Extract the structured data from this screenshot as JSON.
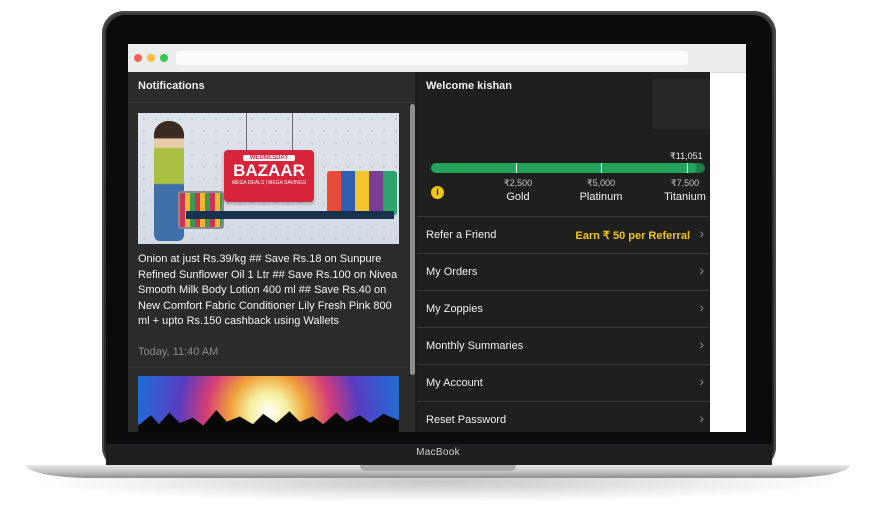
{
  "device": {
    "brand_label": "MacBook"
  },
  "notifications": {
    "title": "Notifications",
    "items": [
      {
        "banner_title": "BAZAAR",
        "banner_kicker": "WEDNESDAY",
        "banner_sub": "MEGA DEALS | MEGA SAVINGS",
        "text": "Onion at just Rs.39/kg ## Save Rs.18 on Sunpure Refined Sunflower Oil 1 Ltr ## Save Rs.100 on Nivea Smooth Milk Body Lotion 400 ml ## Save Rs.40 on New Comfort Fabric Conditioner Lily Fresh Pink 800 ml + upto Rs.150 cashback using Wallets",
        "time": "Today, 11:40 AM"
      }
    ]
  },
  "account": {
    "welcome": "Welcome kishan",
    "progress": {
      "current_value": 11051,
      "current_label": "₹11,051",
      "fraction": 0.97,
      "info_icon": "info-icon",
      "tiers": [
        {
          "amount": "₹2,500",
          "name": "Gold"
        },
        {
          "amount": "₹5,000",
          "name": "Platinum"
        },
        {
          "amount": "₹7,500",
          "name": "Titanium"
        }
      ]
    },
    "menu": [
      {
        "label": "Refer a Friend",
        "extra": "Earn ₹ 50 per Referral"
      },
      {
        "label": "My Orders"
      },
      {
        "label": "My Zoppies"
      },
      {
        "label": "Monthly Summaries"
      },
      {
        "label": "My Account"
      },
      {
        "label": "Reset Password"
      }
    ],
    "chevron": "›"
  },
  "colors": {
    "accent_yellow": "#f2c31a",
    "progress_green": "#24a35a",
    "panel_dark": "#2b2b2c"
  }
}
